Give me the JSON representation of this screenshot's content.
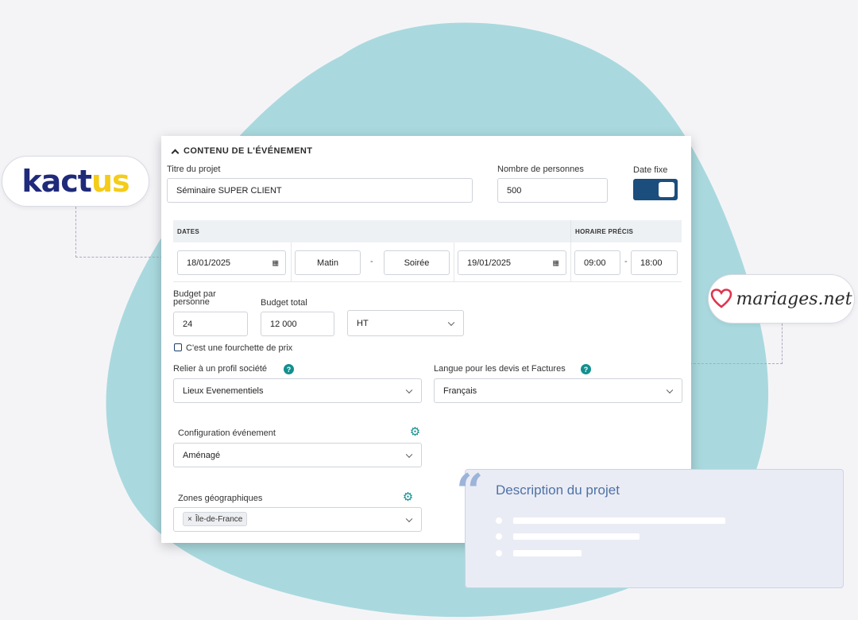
{
  "colors": {
    "background": "#f4f4f7",
    "blob": "#a9d9de",
    "toggle": "#1c4e7d",
    "accent_teal": "#138f8f",
    "description_title": "#4e72a6"
  },
  "partners": {
    "kactus": {
      "logo_part1": "kact",
      "logo_part2": "us"
    },
    "mariages": {
      "logo_text": "mariages.net",
      "icon": "heart-icon"
    }
  },
  "form": {
    "section_title": "CONTENU DE L'ÉVÉNEMENT",
    "project_title_label": "Titre du projet",
    "project_title_value": "Séminaire SUPER CLIENT",
    "people_label": "Nombre de personnes",
    "people_value": "500",
    "fixed_date_label": "Date fixe",
    "fixed_date_on": true,
    "dates_header": "DATES",
    "precise_time_header": "HORAIRE PRÉCIS",
    "start_date": "18/01/2025",
    "start_period": "Matin",
    "date_separator": "-",
    "end_period": "Soirée",
    "end_date": "19/01/2025",
    "start_time": "09:00",
    "time_separator": "-",
    "end_time": "18:00",
    "budget_per_person_label_1": "Budget par",
    "budget_per_person_label_2": "personne",
    "budget_per_person_value": "24",
    "budget_total_label": "Budget total",
    "budget_total_value": "12 000",
    "tax_mode": "HT",
    "price_range_label": "C'est une fourchette de prix",
    "price_range_checked": false,
    "company_profile_label": "Relier à un profil société",
    "company_profile_value": "Lieux Evenementiels",
    "language_label": "Langue pour les devis et Factures",
    "language_value": "Français",
    "event_config_label": "Configuration événement",
    "event_config_value": "Aménagé",
    "zones_label": "Zones géographiques",
    "zones_tags": [
      "Île-de-France"
    ],
    "help_glyph": "?",
    "tag_remove_glyph": "×"
  },
  "description": {
    "title": "Description du projet",
    "quote_glyph": "“"
  }
}
